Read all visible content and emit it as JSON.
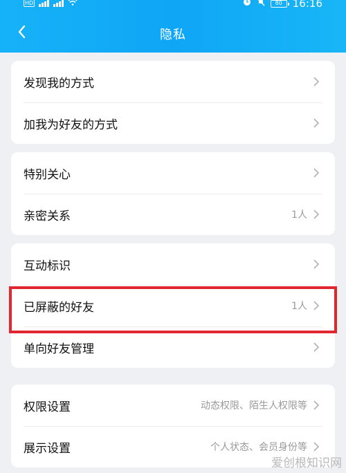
{
  "status_bar": {
    "left_badge": "HD",
    "time": "16:16",
    "battery": "80"
  },
  "header": {
    "title": "隐私"
  },
  "sections": [
    {
      "items": [
        {
          "label": "发现我的方式",
          "value": ""
        },
        {
          "label": "加我为好友的方式",
          "value": ""
        }
      ]
    },
    {
      "items": [
        {
          "label": "特别关心",
          "value": ""
        },
        {
          "label": "亲密关系",
          "value": "1人"
        }
      ]
    },
    {
      "items": [
        {
          "label": "互动标识",
          "value": ""
        },
        {
          "label": "已屏蔽的好友",
          "value": "1人"
        },
        {
          "label": "单向好友管理",
          "value": ""
        }
      ]
    },
    {
      "items": [
        {
          "label": "权限设置",
          "value": "动态权限、陌生人权限等"
        },
        {
          "label": "展示设置",
          "value": "个人状态、会员身份等"
        }
      ]
    }
  ],
  "highlight_color": "#e1262d",
  "accent_color": "#0fa6f6",
  "watermark": "爱创根知识网"
}
